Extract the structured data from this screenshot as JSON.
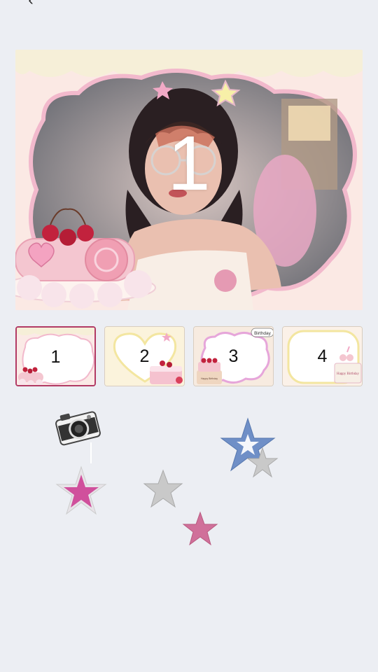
{
  "nav": {
    "back_icon": "chevron-left-icon"
  },
  "preview": {
    "frame_number": "1"
  },
  "frames": [
    {
      "number": "1",
      "selected": true,
      "theme": "cherry-cake-cloud"
    },
    {
      "number": "2",
      "selected": false,
      "theme": "heart-cake"
    },
    {
      "number": "3",
      "selected": false,
      "theme": "cloud-birthday-cake",
      "bubble": "Birthday",
      "cake_label": "Happy Birthday"
    },
    {
      "number": "4",
      "selected": false,
      "theme": "birthday-cake",
      "cake_label": "Happy Birthday"
    }
  ],
  "stickers": [
    {
      "name": "camera-sticker",
      "icon": "camera-icon"
    },
    {
      "name": "blue-star-sticker",
      "icon": "star-icon",
      "color": "#6f8fc7"
    },
    {
      "name": "silver-star-sticker-right",
      "icon": "star-icon",
      "color": "#c9c9c9"
    },
    {
      "name": "pink-star-sticker-large",
      "icon": "star-icon",
      "color": "#d0509c"
    },
    {
      "name": "silver-star-sticker-center",
      "icon": "star-icon",
      "color": "#c9c9c9"
    },
    {
      "name": "pink-star-sticker-small",
      "icon": "star-icon",
      "color": "#d0709a"
    }
  ],
  "colors": {
    "background": "#eceef3",
    "selected_border": "#b23a64",
    "frame_pink": "#f7c7d6"
  }
}
